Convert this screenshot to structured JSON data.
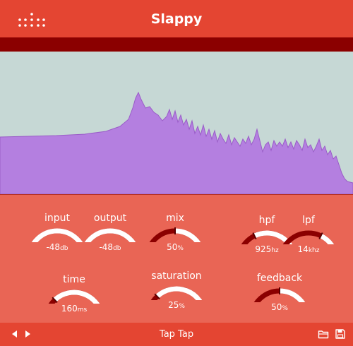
{
  "header": {
    "title": "Slappy"
  },
  "knobs": {
    "input": {
      "label": "input",
      "value": "-48",
      "unit": "db",
      "level": 0.0
    },
    "output": {
      "label": "output",
      "value": "-48",
      "unit": "db",
      "level": 0.0
    },
    "mix": {
      "label": "mix",
      "value": "50",
      "unit": "%",
      "level": 0.5
    },
    "hpf": {
      "label": "hpf",
      "value": "925",
      "unit": "hz",
      "level": 0.35
    },
    "lpf": {
      "label": "lpf",
      "value": "14",
      "unit": "khz",
      "level": 0.65
    },
    "time": {
      "label": "time",
      "value": "160",
      "unit": "ms",
      "level": 0.25
    },
    "saturation": {
      "label": "saturation",
      "value": "25",
      "unit": "%",
      "level": 0.25
    },
    "feedback": {
      "label": "feedback",
      "value": "50",
      "unit": "%",
      "level": 0.5
    }
  },
  "footer": {
    "preset_name": "Tap Tap"
  },
  "icons": {
    "logo": "dots-logo-icon",
    "prev": "triangle-left-icon",
    "next": "triangle-right-icon",
    "open": "folder-icon",
    "save": "floppy-disk-icon"
  },
  "colors": {
    "header": "#e44532",
    "dark_bar": "#8b0000",
    "spectrum_bg": "#c6d8d5",
    "spectrum_fill": "#b47fe0",
    "panel": "#e96555",
    "knob_track": "#8b0000",
    "knob_fill": "#ffffff"
  }
}
